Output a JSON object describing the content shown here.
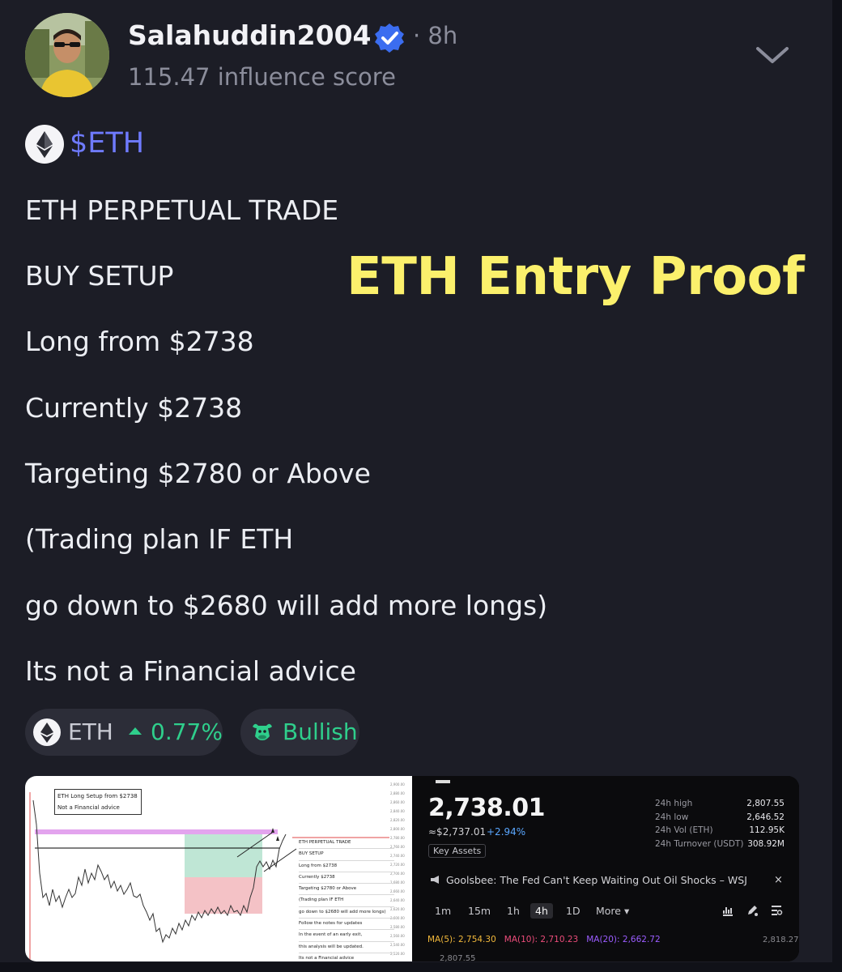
{
  "post": {
    "username": "Salahuddin2004",
    "age": "· 8h",
    "score": "115.47 influence score",
    "ticker": "$ETH",
    "lines": [
      "ETH PERPETUAL TRADE",
      "BUY SETUP",
      "Long from $2738",
      "Currently $2738",
      "Targeting $2780 or Above",
      "(Trading plan IF ETH",
      "go down to $2680 will add more longs)",
      "Its not a Financial advice"
    ],
    "overlay": "ETH Entry Proof"
  },
  "pills": {
    "eth_symbol": "ETH",
    "eth_change": "0.77%",
    "sentiment": "Bullish"
  },
  "chart_image": {
    "note_title": "ETH Long Setup from $2738",
    "note_sub": "Not a Financial advice",
    "plan": [
      "ETH PERPETUAL TRADE",
      "BUY SETUP",
      "Long from $2738",
      "Currently $2738",
      "Targeting $2780 or Above",
      "(Trading plan IF ETH",
      "go down to $2680 will add more longs)",
      "Follow the notes for updates",
      "In the event of an early exit,",
      "this analysis will be updated.",
      "Its not a Financial advice"
    ]
  },
  "trade": {
    "price": "2,738.01",
    "subprice": "≈$2,737.01",
    "change": "+2.94%",
    "key_assets": "Key Assets",
    "stats": [
      {
        "label": "24h high",
        "value": "2,807.55"
      },
      {
        "label": "24h low",
        "value": "2,646.52"
      },
      {
        "label": "24h Vol (ETH)",
        "value": "112.95K"
      },
      {
        "label": "24h Turnover (USDT)",
        "value": "308.92M"
      }
    ],
    "news": "Goolsbee: The Fed Can't Keep Waiting Out Oil Shocks – WSJ",
    "close": "×",
    "timeframes": [
      "1m",
      "15m",
      "1h",
      "4h",
      "1D",
      "More ▾"
    ],
    "ma5": "MA(5): 2,754.30",
    "ma10": "MA(10): 2,710.23",
    "ma20": "MA(20): 2,662.72",
    "scale_value": "2,818.27",
    "cut_value": "2,807.55"
  },
  "colors": {
    "background": "#1c1d26",
    "ticker": "#6f7bff",
    "positive": "#2fcf8c",
    "overlay": "#fbf06c",
    "verified": "#3b6df0"
  }
}
